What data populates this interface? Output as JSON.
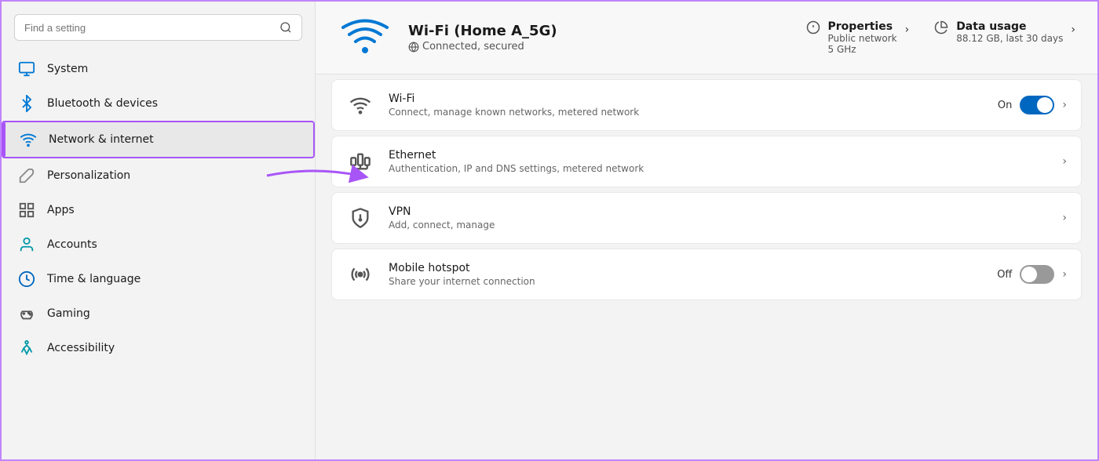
{
  "sidebar": {
    "search": {
      "placeholder": "Find a setting",
      "value": ""
    },
    "items": [
      {
        "id": "system",
        "label": "System",
        "icon": "monitor",
        "active": false
      },
      {
        "id": "bluetooth",
        "label": "Bluetooth & devices",
        "icon": "bluetooth",
        "active": false
      },
      {
        "id": "network",
        "label": "Network & internet",
        "icon": "wifi",
        "active": true
      },
      {
        "id": "personalization",
        "label": "Personalization",
        "icon": "brush",
        "active": false
      },
      {
        "id": "apps",
        "label": "Apps",
        "icon": "apps",
        "active": false
      },
      {
        "id": "accounts",
        "label": "Accounts",
        "icon": "person",
        "active": false
      },
      {
        "id": "time",
        "label": "Time & language",
        "icon": "clock",
        "active": false
      },
      {
        "id": "gaming",
        "label": "Gaming",
        "icon": "gamepad",
        "active": false
      },
      {
        "id": "accessibility",
        "label": "Accessibility",
        "icon": "person-circle",
        "active": false
      }
    ]
  },
  "header": {
    "wifi_name": "Wi-Fi (Home A_5G)",
    "wifi_status": "Connected, secured",
    "properties": {
      "label": "Properties",
      "sub1": "Public network",
      "sub2": "5 GHz"
    },
    "data_usage": {
      "label": "Data usage",
      "sub1": "88.12 GB, last 30 days"
    }
  },
  "settings_items": [
    {
      "id": "wifi",
      "title": "Wi-Fi",
      "subtitle": "Connect, manage known networks, metered network",
      "has_toggle": true,
      "toggle_state": "on",
      "toggle_label": "On",
      "has_chevron": true,
      "icon": "wifi"
    },
    {
      "id": "ethernet",
      "title": "Ethernet",
      "subtitle": "Authentication, IP and DNS settings, metered network",
      "has_toggle": false,
      "has_chevron": true,
      "icon": "ethernet"
    },
    {
      "id": "vpn",
      "title": "VPN",
      "subtitle": "Add, connect, manage",
      "has_toggle": false,
      "has_chevron": true,
      "icon": "vpn"
    },
    {
      "id": "hotspot",
      "title": "Mobile hotspot",
      "subtitle": "Share your internet connection",
      "has_toggle": true,
      "toggle_state": "off",
      "toggle_label": "Off",
      "has_chevron": true,
      "icon": "hotspot"
    }
  ]
}
